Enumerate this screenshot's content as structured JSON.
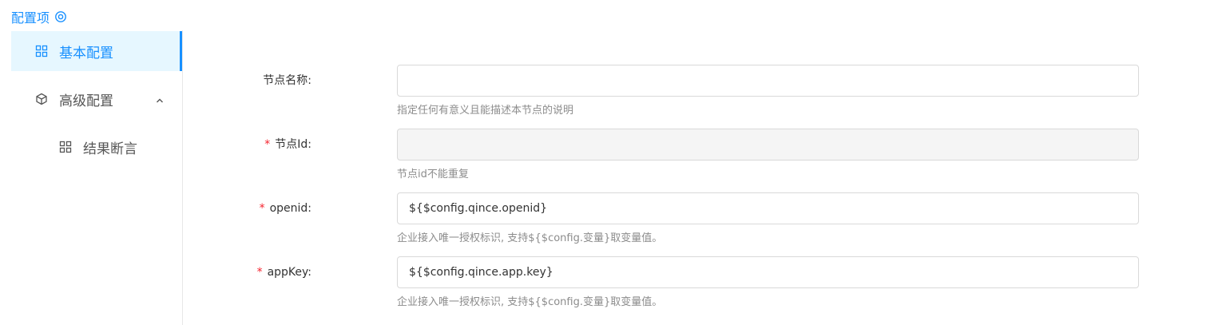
{
  "header": {
    "title": "配置项",
    "icon": "gear-icon",
    "accent": "#1890ff"
  },
  "sidebar": {
    "items": [
      {
        "label": "基本配置",
        "icon": "grid-icon",
        "active": true
      },
      {
        "label": "高级配置",
        "icon": "cube-icon",
        "expanded": true
      },
      {
        "label": "结果断言",
        "icon": "grid-icon"
      }
    ]
  },
  "form": {
    "fields": [
      {
        "label": "节点名称",
        "colon": ":",
        "required": false,
        "value": "",
        "help": "指定任何有意义且能描述本节点的说明"
      },
      {
        "label": "节点Id",
        "colon": ":",
        "required": true,
        "required_mark": "*",
        "value": "",
        "disabled": true,
        "help": "节点id不能重复"
      },
      {
        "label": "openid",
        "colon": ":",
        "required": true,
        "required_mark": "*",
        "value": "${$config.qince.openid}",
        "help": "企业接入唯一授权标识, 支持${$config.变量}取变量值。"
      },
      {
        "label": "appKey",
        "colon": ":",
        "required": true,
        "required_mark": "*",
        "value": "${$config.qince.app.key}",
        "help": "企业接入唯一授权标识, 支持${$config.变量}取变量值。"
      }
    ]
  }
}
